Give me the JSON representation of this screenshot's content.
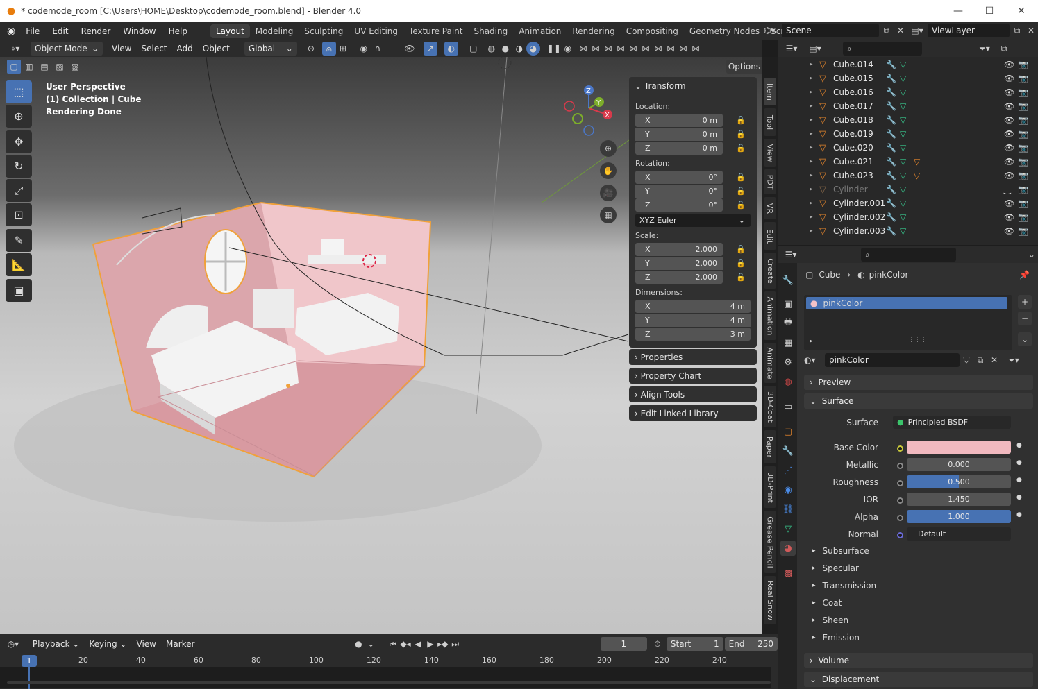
{
  "window": {
    "title": "* codemode_room [C:\\Users\\HOME\\Desktop\\codemode_room.blend] - Blender 4.0",
    "minimize": "—",
    "maximize": "☐",
    "close": "✕"
  },
  "menu": {
    "items": [
      "File",
      "Edit",
      "Render",
      "Window",
      "Help"
    ],
    "workspaces": [
      "Layout",
      "Modeling",
      "Sculpting",
      "UV Editing",
      "Texture Paint",
      "Shading",
      "Animation",
      "Rendering",
      "Compositing",
      "Geometry Nodes",
      "Scripting"
    ],
    "scene": "Scene",
    "viewlayer": "ViewLayer"
  },
  "viewport_header": {
    "mode": "Object Mode",
    "view": "View",
    "select": "Select",
    "add": "Add",
    "object": "Object",
    "transform": "Global",
    "options": "Options"
  },
  "overlay": {
    "line1": "User Perspective",
    "line2": "(1) Collection | Cube",
    "line3": "Rendering Done"
  },
  "npanel": {
    "transform": "Transform",
    "location": "Location:",
    "rotation": "Rotation:",
    "scale": "Scale:",
    "dimensions": "Dimensions:",
    "rot_mode": "XYZ Euler",
    "loc": [
      {
        "axis": "X",
        "value": "0 m"
      },
      {
        "axis": "Y",
        "value": "0 m"
      },
      {
        "axis": "Z",
        "value": "0 m"
      }
    ],
    "rot": [
      {
        "axis": "X",
        "value": "0°"
      },
      {
        "axis": "Y",
        "value": "0°"
      },
      {
        "axis": "Z",
        "value": "0°"
      }
    ],
    "scl": [
      {
        "axis": "X",
        "value": "2.000"
      },
      {
        "axis": "Y",
        "value": "2.000"
      },
      {
        "axis": "Z",
        "value": "2.000"
      }
    ],
    "dim": [
      {
        "axis": "X",
        "value": "4 m"
      },
      {
        "axis": "Y",
        "value": "4 m"
      },
      {
        "axis": "Z",
        "value": "3 m"
      }
    ],
    "subpanels": [
      "Properties",
      "Property Chart",
      "Align Tools",
      "Edit Linked Library"
    ]
  },
  "sidebar_tabs": [
    "Item",
    "Tool",
    "View",
    "PDT",
    "VR",
    "Edit",
    "Create",
    "Animation",
    "Animate",
    "3D-Coat",
    "Paper",
    "3D-Print",
    "Grease Pencil",
    "Real Snow"
  ],
  "gizmo": {
    "x": "X",
    "y": "Y",
    "z": "Z"
  },
  "outliner": {
    "items": [
      {
        "name": "Cube.014",
        "dim": false,
        "mat": false
      },
      {
        "name": "Cube.015",
        "dim": false,
        "mat": false
      },
      {
        "name": "Cube.016",
        "dim": false,
        "mat": false
      },
      {
        "name": "Cube.017",
        "dim": false,
        "mat": false
      },
      {
        "name": "Cube.018",
        "dim": false,
        "mat": false
      },
      {
        "name": "Cube.019",
        "dim": false,
        "mat": false
      },
      {
        "name": "Cube.020",
        "dim": false,
        "mat": false
      },
      {
        "name": "Cube.021",
        "dim": false,
        "mat": true
      },
      {
        "name": "Cube.023",
        "dim": false,
        "mat": true
      },
      {
        "name": "Cylinder",
        "dim": true,
        "mat": false
      },
      {
        "name": "Cylinder.001",
        "dim": false,
        "mat": false
      },
      {
        "name": "Cylinder.002",
        "dim": false,
        "mat": false
      },
      {
        "name": "Cylinder.003",
        "dim": false,
        "mat": false
      }
    ]
  },
  "properties": {
    "crumb_obj": "Cube",
    "crumb_mat": "pinkColor",
    "slot": "pinkColor",
    "material_name": "pinkColor",
    "preview": "Preview",
    "surface_hdr": "Surface",
    "surface_label": "Surface",
    "surface_value": "Principled BSDF",
    "base_color_label": "Base Color",
    "base_color": "#f1b9bf",
    "metallic_label": "Metallic",
    "metallic": "0.000",
    "roughness_label": "Roughness",
    "roughness": "0.500",
    "roughness_frac": 0.5,
    "ior_label": "IOR",
    "ior": "1.450",
    "alpha_label": "Alpha",
    "alpha": "1.000",
    "normal_label": "Normal",
    "normal": "Default",
    "subsections": [
      "Subsurface",
      "Specular",
      "Transmission",
      "Coat",
      "Sheen",
      "Emission"
    ],
    "volume": "Volume",
    "displacement": "Displacement"
  },
  "timeline": {
    "playback": "Playback",
    "keying": "Keying",
    "view": "View",
    "marker": "Marker",
    "current": "1",
    "start_label": "Start",
    "start": "1",
    "end_label": "End",
    "end": "250",
    "ticks": [
      "20",
      "40",
      "60",
      "80",
      "100",
      "120",
      "140",
      "160",
      "180",
      "200",
      "220",
      "240"
    ],
    "playhead": "1"
  },
  "colors": {
    "accent": "#4772b3",
    "selection": "#f0a13a",
    "room": "#e7b6bb"
  }
}
